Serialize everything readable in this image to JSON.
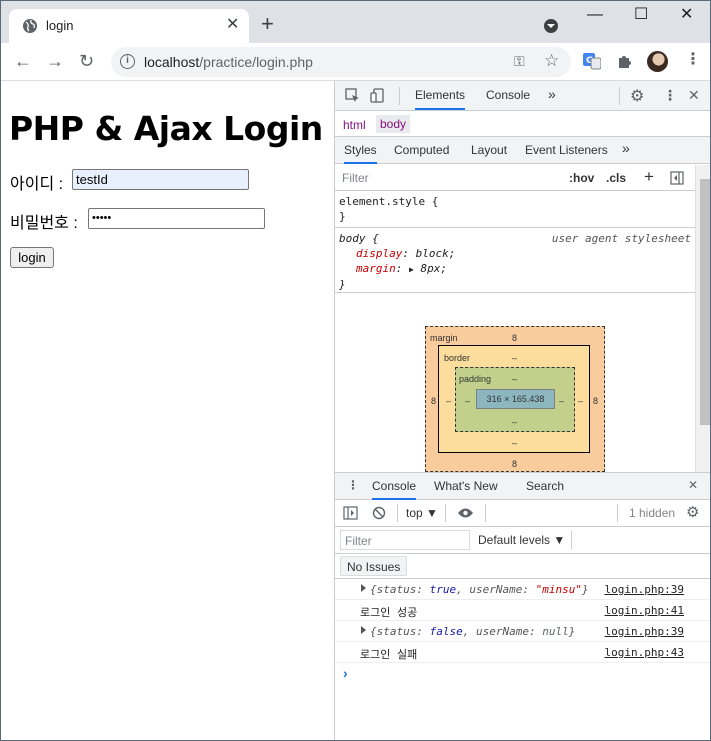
{
  "browser": {
    "tab_title": "login",
    "tab_close": "✕",
    "new_tab": "+",
    "window_controls": {
      "minimize": "—",
      "maximize": "☐",
      "close": "✕"
    },
    "url_host": "localhost",
    "url_path": "/practice/login.php",
    "nav": {
      "back": "←",
      "forward": "→",
      "reload": "↻"
    }
  },
  "page": {
    "heading": "PHP & Ajax Login",
    "id_label": "아이디 : ",
    "id_value": "testId",
    "pw_label": "비밀번호 : ",
    "pw_value": "•••••",
    "login_button": "login"
  },
  "devtools": {
    "tabs": [
      "Elements",
      "Console",
      "»"
    ],
    "active_tab": "Elements",
    "breadcrumbs": [
      "html",
      "body"
    ],
    "styles_tabs": [
      "Styles",
      "Computed",
      "Layout",
      "Event Listeners",
      "»"
    ],
    "filter_placeholder": "Filter",
    "hov": ":hov",
    "cls": ".cls",
    "element_style_open": "element.style {",
    "close_brace": "}",
    "body_selector": "body {",
    "user_agent": "user agent stylesheet",
    "prop_display_name": "display",
    "prop_display_value": "block",
    "prop_margin_name": "margin",
    "prop_margin_value": "8px",
    "box_model": {
      "margin_label": "margin",
      "border_label": "border",
      "padding_label": "padding",
      "margin_top": "8",
      "margin_bottom": "8",
      "margin_left": "8",
      "margin_right": "8",
      "border_top": "–",
      "border_bottom": "–",
      "border_left": "–",
      "border_right": "–",
      "padding_top": "–",
      "padding_bottom": "–",
      "padding_left": "–",
      "padding_right": "–",
      "content": "316 × 165.438"
    },
    "drawer_tabs": [
      "Console",
      "What's New",
      "Search"
    ],
    "context": "top",
    "console_filter_placeholder": "Filter",
    "default_levels": "Default levels ▼",
    "hidden_count": "1 hidden",
    "no_issues": "No Issues",
    "logs": [
      {
        "type": "object",
        "status_key": "status",
        "status_value": "true",
        "user_key": "userName",
        "user_value": "\"minsu\"",
        "source": "login.php:39"
      },
      {
        "type": "text",
        "text": "로그인 성공",
        "source": "login.php:41"
      },
      {
        "type": "object",
        "status_key": "status",
        "status_value": "false",
        "user_key": "userName",
        "user_value": "null",
        "source": "login.php:39"
      },
      {
        "type": "text",
        "text": "로그인 실패",
        "source": "login.php:43"
      }
    ],
    "prompt": "›"
  }
}
